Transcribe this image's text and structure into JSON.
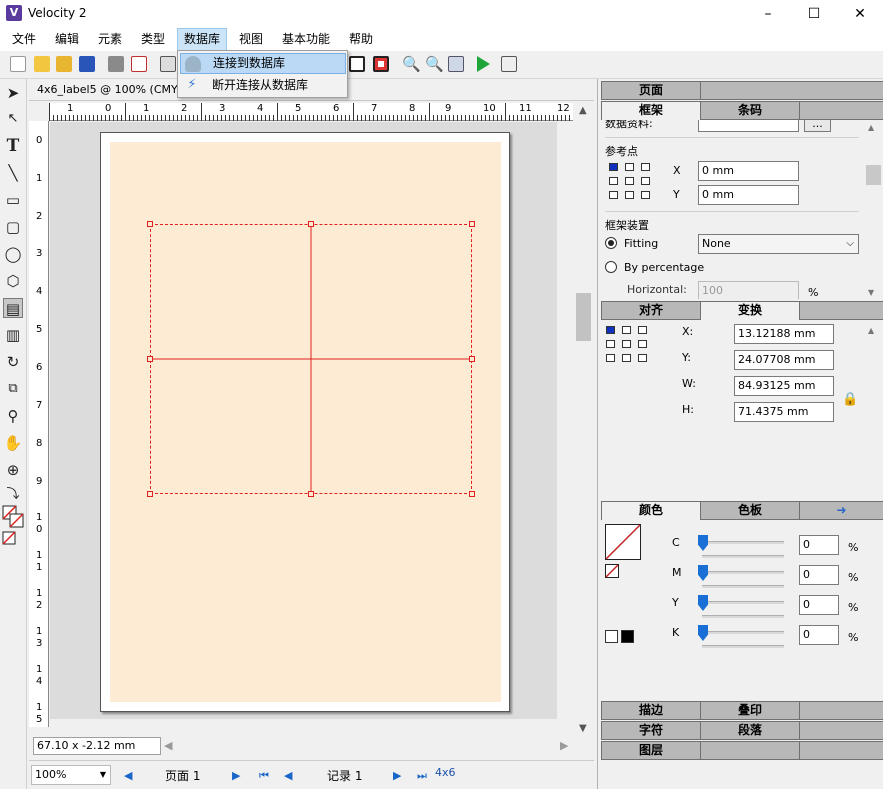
{
  "window": {
    "title": "Velocity 2",
    "icon": "app-logo-icon",
    "minimize": "–",
    "maximize": "☐",
    "close": "✕"
  },
  "menubar": [
    "文件",
    "编辑",
    "元素",
    "类型",
    "数据库",
    "视图",
    "基本功能",
    "帮助"
  ],
  "database_menu": {
    "connect": "连接到数据库",
    "disconnect": "断开连接从数据库"
  },
  "document": {
    "tab_title": "4x6_label5 @ 100% (CMYK)",
    "ruler_h": [
      "1",
      "0",
      "1",
      "2",
      "3",
      "4",
      "5",
      "6",
      "7",
      "8",
      "9",
      "10",
      "11",
      "12"
    ],
    "ruler_v": [
      "0",
      "1",
      "2",
      "3",
      "4",
      "5",
      "6",
      "7",
      "8",
      "9",
      "1",
      "0",
      "1",
      "1",
      "1",
      "2",
      "1",
      "3",
      "1",
      "4",
      "1",
      "5"
    ],
    "status": "67.10 x -2.12 mm"
  },
  "bottombar": {
    "zoom": "100%",
    "page": "页面 1",
    "record": "记录 1",
    "label_size": "4x6"
  },
  "panel": {
    "top_tabs": {
      "page": "页面",
      "frame": "框架",
      "barcode": "条码"
    },
    "frame": {
      "data_source_label": "数据资料:",
      "browse": "...",
      "ref_point_label": "参考点",
      "x_label": "X",
      "x_value": "0 mm",
      "y_label": "Y",
      "y_value": "0 mm",
      "fitting_section": "框架装置",
      "fitting_label": "Fitting",
      "fitting_value": "None",
      "by_pct_label": "By percentage",
      "horizontal_label": "Horizontal:",
      "horizontal_value": "100",
      "horizontal_unit": "%"
    },
    "transform_tabs": {
      "align": "对齐",
      "transform": "变换"
    },
    "transform": {
      "x_label": "X:",
      "x_value": "13.12188 mm",
      "y_label": "Y:",
      "y_value": "24.07708 mm",
      "w_label": "W:",
      "w_value": "84.93125 mm",
      "h_label": "H:",
      "h_value": "71.4375 mm"
    },
    "color_tabs": {
      "color": "颜色",
      "swatches": "色板"
    },
    "cmyk": [
      {
        "label": "C",
        "value": "0",
        "unit": "%"
      },
      {
        "label": "M",
        "value": "0",
        "unit": "%"
      },
      {
        "label": "Y",
        "value": "0",
        "unit": "%"
      },
      {
        "label": "K",
        "value": "0",
        "unit": "%"
      }
    ],
    "bottom_tabs": {
      "stroke": "描边",
      "overprint": "叠印",
      "character": "字符",
      "paragraph": "段落",
      "layers": "图层"
    }
  },
  "colors": {
    "accent": "#1a6fd6",
    "frame_border": "#e02020",
    "label_fill": "#fdebd3",
    "highlight": "#bbd9f5"
  }
}
